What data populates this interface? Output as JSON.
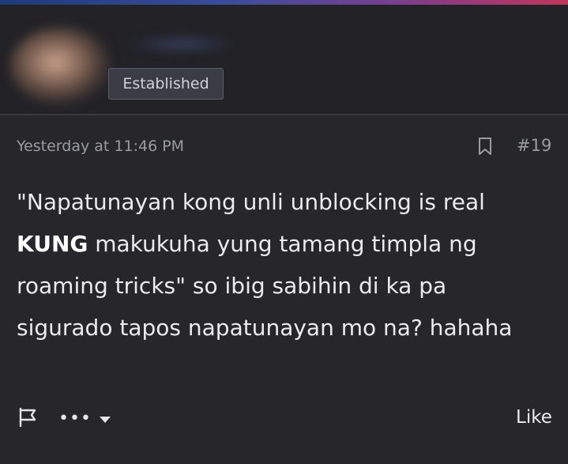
{
  "user": {
    "badge": "Established"
  },
  "post": {
    "timestamp": "Yesterday at 11:46 PM",
    "number": "#19",
    "text_part1": "\"Napatunayan kong unli unblocking is real ",
    "text_bold": "KUNG",
    "text_part2": " makukuha yung tamang timpla ng roaming tricks\" so ibig sabihin di ka pa sigurado tapos napatunayan mo na? hahaha"
  },
  "actions": {
    "more_dots": "•••",
    "like_label": "Like"
  },
  "icons": {
    "bookmark": "bookmark-icon",
    "flag": "flag-icon",
    "more": "more-options-icon",
    "caret": "chevron-down-icon"
  },
  "colors": {
    "background": "#26262b",
    "header_background": "#222227",
    "text_primary": "#ececef",
    "text_muted": "#9b9ca3",
    "badge_background": "#3a3d46"
  }
}
